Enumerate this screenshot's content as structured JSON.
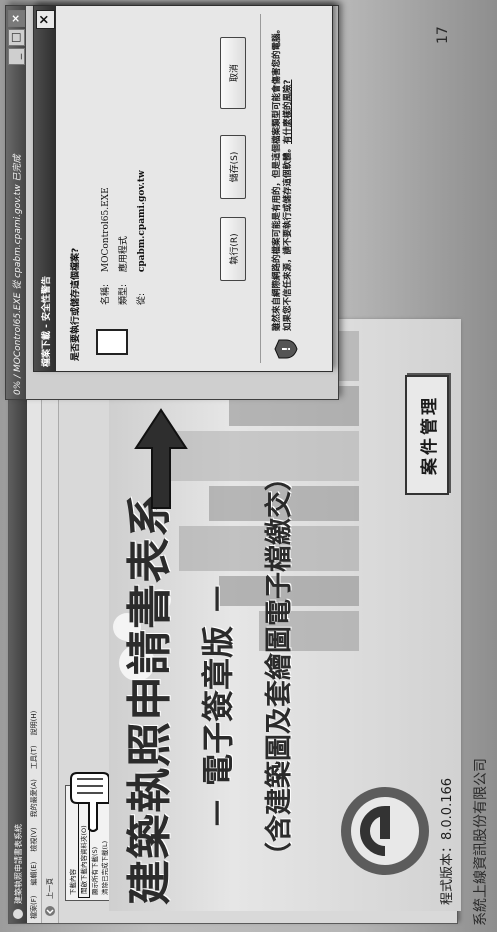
{
  "app_window": {
    "title": "建築執照申請書表系統",
    "menu": [
      "檔案(F)",
      "編輯(E)",
      "檢視(V)",
      "我的最愛(A)",
      "工具(T)",
      "說明(H)"
    ],
    "toolbar": [
      "上一頁"
    ],
    "download_panel": [
      "下載內容",
      "開啟下載內容資料夾(O)",
      "顯示所有下載(S)",
      "清除已完成下載(L)"
    ]
  },
  "slide": {
    "title": "建築執照申請書表系",
    "subtitle": "－ 電子簽章版 －",
    "parenthetical": "（含建築圖及套繪圖電子檔繳交）",
    "version": "程式版本：8.0.0.166",
    "case_button": "案件管理"
  },
  "download_window": {
    "title": "0% / MOControl65.EXE 從 cpabm.cpami.gov.tw 已完成"
  },
  "security_dialog": {
    "title": "檔案下載 - 安全性警告",
    "question": "是否要執行或儲存這個檔案?",
    "fields": [
      {
        "label": "名稱:",
        "value": "MOControl65.EXE"
      },
      {
        "label": "類型:",
        "value": "應用程式"
      },
      {
        "label": "從:",
        "value": "cpabm.cpami.gov.tw"
      }
    ],
    "buttons": {
      "run": "執行(R)",
      "save": "儲存(S)",
      "cancel": "取消"
    },
    "warning": "雖然來自網際網路的檔案可能是有用的，但是這個檔案類型可能會傷害您的電腦。如果您不信任來源，請不要執行或儲存這個軟體。",
    "warning_link": "有什麼樣的風險?"
  },
  "page_number": "17",
  "company": "系統上線資訊股份有限公司",
  "colors": {
    "title_text": "#2b2b2b",
    "dialog_titlebar": "#3a3a3a"
  }
}
